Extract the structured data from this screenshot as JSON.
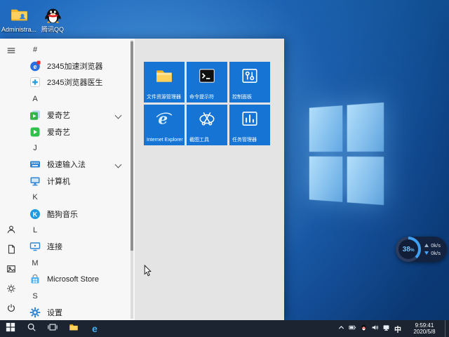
{
  "colors": {
    "tile_blue": "#1574d4",
    "taskbar": "#1b2430",
    "wallpaper_blue": "#155a9f",
    "accent": "#0078d7"
  },
  "desktop": {
    "icons": [
      {
        "label": "Administra...",
        "icon": "user-folder"
      },
      {
        "label": "腾讯QQ",
        "icon": "qq-penguin"
      }
    ]
  },
  "start_menu": {
    "rail_icons": [
      "hamburger",
      "user",
      "documents",
      "pictures",
      "settings",
      "power"
    ],
    "app_list": [
      {
        "type": "section",
        "label": "#"
      },
      {
        "type": "app",
        "label": "2345加速浏览器",
        "icon": "2345-browser"
      },
      {
        "type": "app",
        "label": "2345浏览器医生",
        "icon": "2345-doctor"
      },
      {
        "type": "section",
        "label": "A"
      },
      {
        "type": "group",
        "label": "爱奇艺",
        "icon": "iqiyi-group",
        "expandable": true
      },
      {
        "type": "app",
        "label": "爱奇艺",
        "icon": "iqiyi"
      },
      {
        "type": "section",
        "label": "J"
      },
      {
        "type": "group",
        "label": "极速输入法",
        "icon": "jisu-ime",
        "expandable": true
      },
      {
        "type": "app",
        "label": "计算机",
        "icon": "computer"
      },
      {
        "type": "section",
        "label": "K"
      },
      {
        "type": "app",
        "label": "酷狗音乐",
        "icon": "kugou-music"
      },
      {
        "type": "section",
        "label": "L"
      },
      {
        "type": "app",
        "label": "连接",
        "icon": "connect"
      },
      {
        "type": "section",
        "label": "M"
      },
      {
        "type": "app",
        "label": "Microsoft Store",
        "icon": "microsoft-store"
      },
      {
        "type": "section",
        "label": "S"
      },
      {
        "type": "app",
        "label": "设置",
        "icon": "settings-gear"
      }
    ],
    "tiles": [
      {
        "label": "文件资源管理器",
        "icon": "file-explorer"
      },
      {
        "label": "命令提示符",
        "icon": "command-prompt"
      },
      {
        "label": "控制面板",
        "icon": "control-panel"
      },
      {
        "label": "Internet Explorer",
        "icon": "internet-explorer"
      },
      {
        "label": "截图工具",
        "icon": "snipping-tool"
      },
      {
        "label": "任务管理器",
        "icon": "task-manager"
      }
    ]
  },
  "taskbar": {
    "buttons": [
      "start",
      "search",
      "task-view",
      "file-explorer",
      "edge"
    ],
    "tray_icons": [
      "chevron-up",
      "battery",
      "qq",
      "volume",
      "network"
    ],
    "input_indicator": "中",
    "time": "9:59:41",
    "date": "2020/5/8"
  },
  "speed_widget": {
    "percent": "38",
    "percent_unit": "%",
    "upload": "0k/s",
    "download": "0k/s"
  }
}
